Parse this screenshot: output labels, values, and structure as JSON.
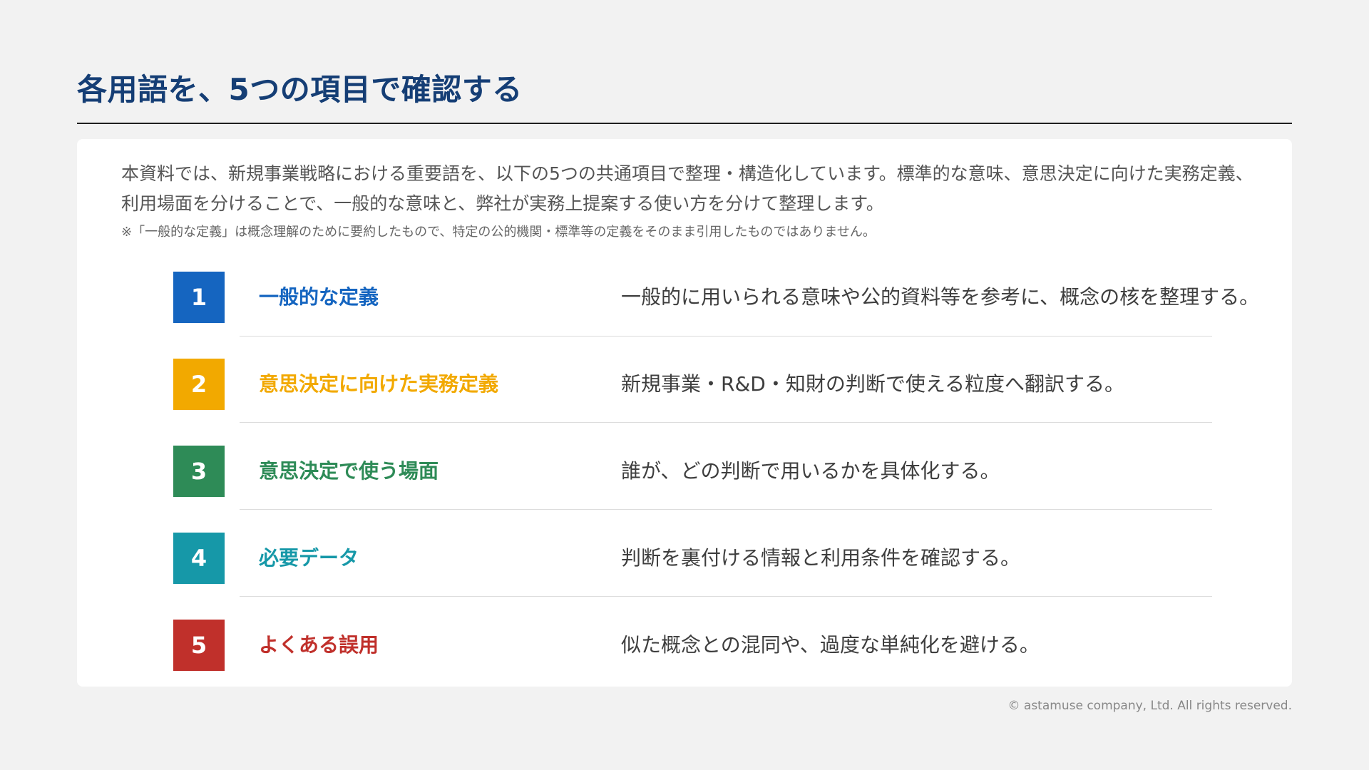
{
  "page": {
    "title": "各用語を、5つの項目で確認する"
  },
  "intro": {
    "text": "本資料では、新規事業戦略における重要語を、以下の5つの共通項目で整理・構造化しています。標準的な意味、意思決定に向けた実務定義、利用場面を分けることで、一般的な意味と、弊社が実務上提案する使い方を分けて整理します。",
    "note": "※「一般的な定義」は概念理解のために要約したもので、特定の公的機関・標準等の定義をそのまま引用したものではありません。"
  },
  "items": [
    {
      "number": "1",
      "title": "一般的な定義",
      "description": "一般的に用いられる意味や公的資料等を参考に、概念の核を整理する。",
      "color": "#1565c0"
    },
    {
      "number": "2",
      "title": "意思決定に向けた実務定義",
      "description": "新規事業・R&D・知財の判断で使える粒度へ翻訳する。",
      "color": "#f2a900"
    },
    {
      "number": "3",
      "title": "意思決定で使う場面",
      "description": "誰が、どの判断で用いるかを具体化する。",
      "color": "#2e8b57"
    },
    {
      "number": "4",
      "title": "必要データ",
      "description": "判断を裏付ける情報と利用条件を確認する。",
      "color": "#1698a8"
    },
    {
      "number": "5",
      "title": "よくある誤用",
      "description": "似た概念との混同や、過度な単純化を避ける。",
      "color": "#c0302b"
    }
  ],
  "footer": {
    "copyright": "© astamuse company, Ltd. All rights reserved."
  }
}
